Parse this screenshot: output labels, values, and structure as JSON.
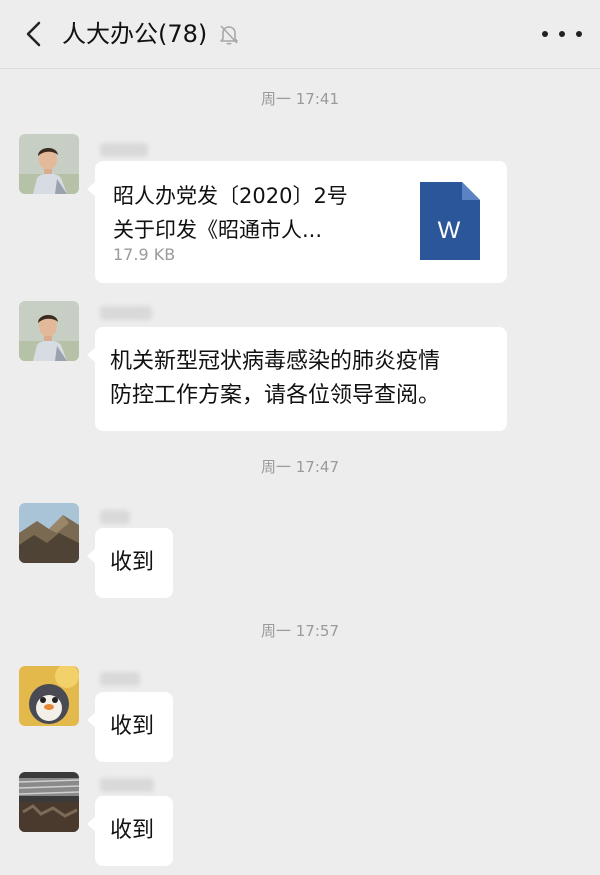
{
  "header": {
    "title": "人大办公(78)"
  },
  "timestamps": [
    "周一 17:41",
    "周一 17:47",
    "周一 17:57"
  ],
  "messages": [
    {
      "type": "file",
      "file_title_line1": "昭人办党发〔2020〕2号",
      "file_title_line2": "关于印发《昭通市人...",
      "file_size": "17.9 KB",
      "file_icon_letter": "W"
    },
    {
      "type": "text",
      "line1": "机关新型冠状病毒感染的肺炎疫情",
      "line2": "防控工作方案，请各位领导查阅。"
    },
    {
      "type": "text",
      "text": "收到"
    },
    {
      "type": "text",
      "text": "收到"
    },
    {
      "type": "text",
      "text": "收到"
    }
  ],
  "colors": {
    "background": "#ededed",
    "bubble": "#ffffff",
    "timestamp": "#9a9a9a",
    "word_blue": "#2b579a"
  },
  "icons": [
    "back-icon",
    "mute-bell-icon",
    "more-icon",
    "word-file-icon"
  ]
}
